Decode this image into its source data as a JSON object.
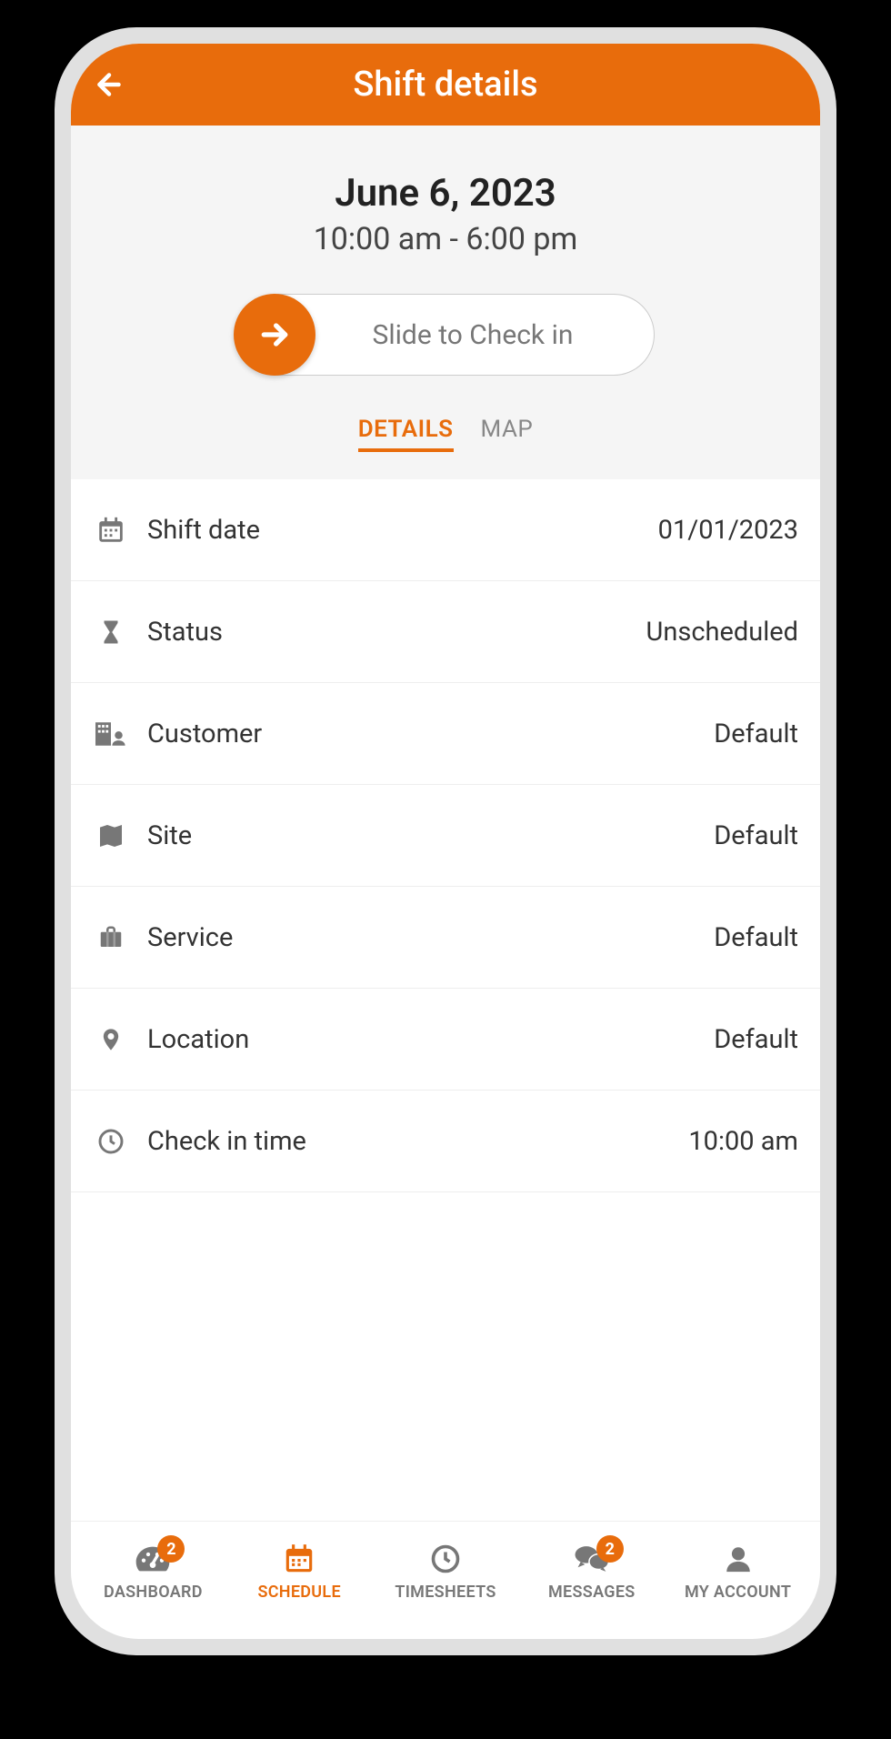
{
  "colors": {
    "accent": "#e86c0c"
  },
  "header": {
    "title": "Shift details"
  },
  "hero": {
    "date": "June 6, 2023",
    "time_range": "10:00 am - 6:00 pm",
    "slide_label": "Slide to Check in"
  },
  "tabs": {
    "details": "DETAILS",
    "map": "MAP",
    "active": "details"
  },
  "rows": [
    {
      "icon": "calendar-icon",
      "label": "Shift date",
      "value": "01/01/2023"
    },
    {
      "icon": "hourglass-icon",
      "label": "Status",
      "value": "Unscheduled"
    },
    {
      "icon": "building-user-icon",
      "label": "Customer",
      "value": "Default"
    },
    {
      "icon": "map-icon",
      "label": "Site",
      "value": "Default"
    },
    {
      "icon": "briefcase-icon",
      "label": "Service",
      "value": "Default"
    },
    {
      "icon": "location-pin-icon",
      "label": "Location",
      "value": "Default"
    },
    {
      "icon": "clock-icon",
      "label": "Check in time",
      "value": "10:00 am"
    }
  ],
  "nav": {
    "items": [
      {
        "icon": "dashboard-icon",
        "label": "DASHBOARD",
        "badge": "2",
        "active": false
      },
      {
        "icon": "calendar-icon",
        "label": "SCHEDULE",
        "badge": null,
        "active": true
      },
      {
        "icon": "clock-icon",
        "label": "TIMESHEETS",
        "badge": null,
        "active": false
      },
      {
        "icon": "messages-icon",
        "label": "MESSAGES",
        "badge": "2",
        "active": false
      },
      {
        "icon": "user-icon",
        "label": "MY ACCOUNT",
        "badge": null,
        "active": false
      }
    ]
  }
}
